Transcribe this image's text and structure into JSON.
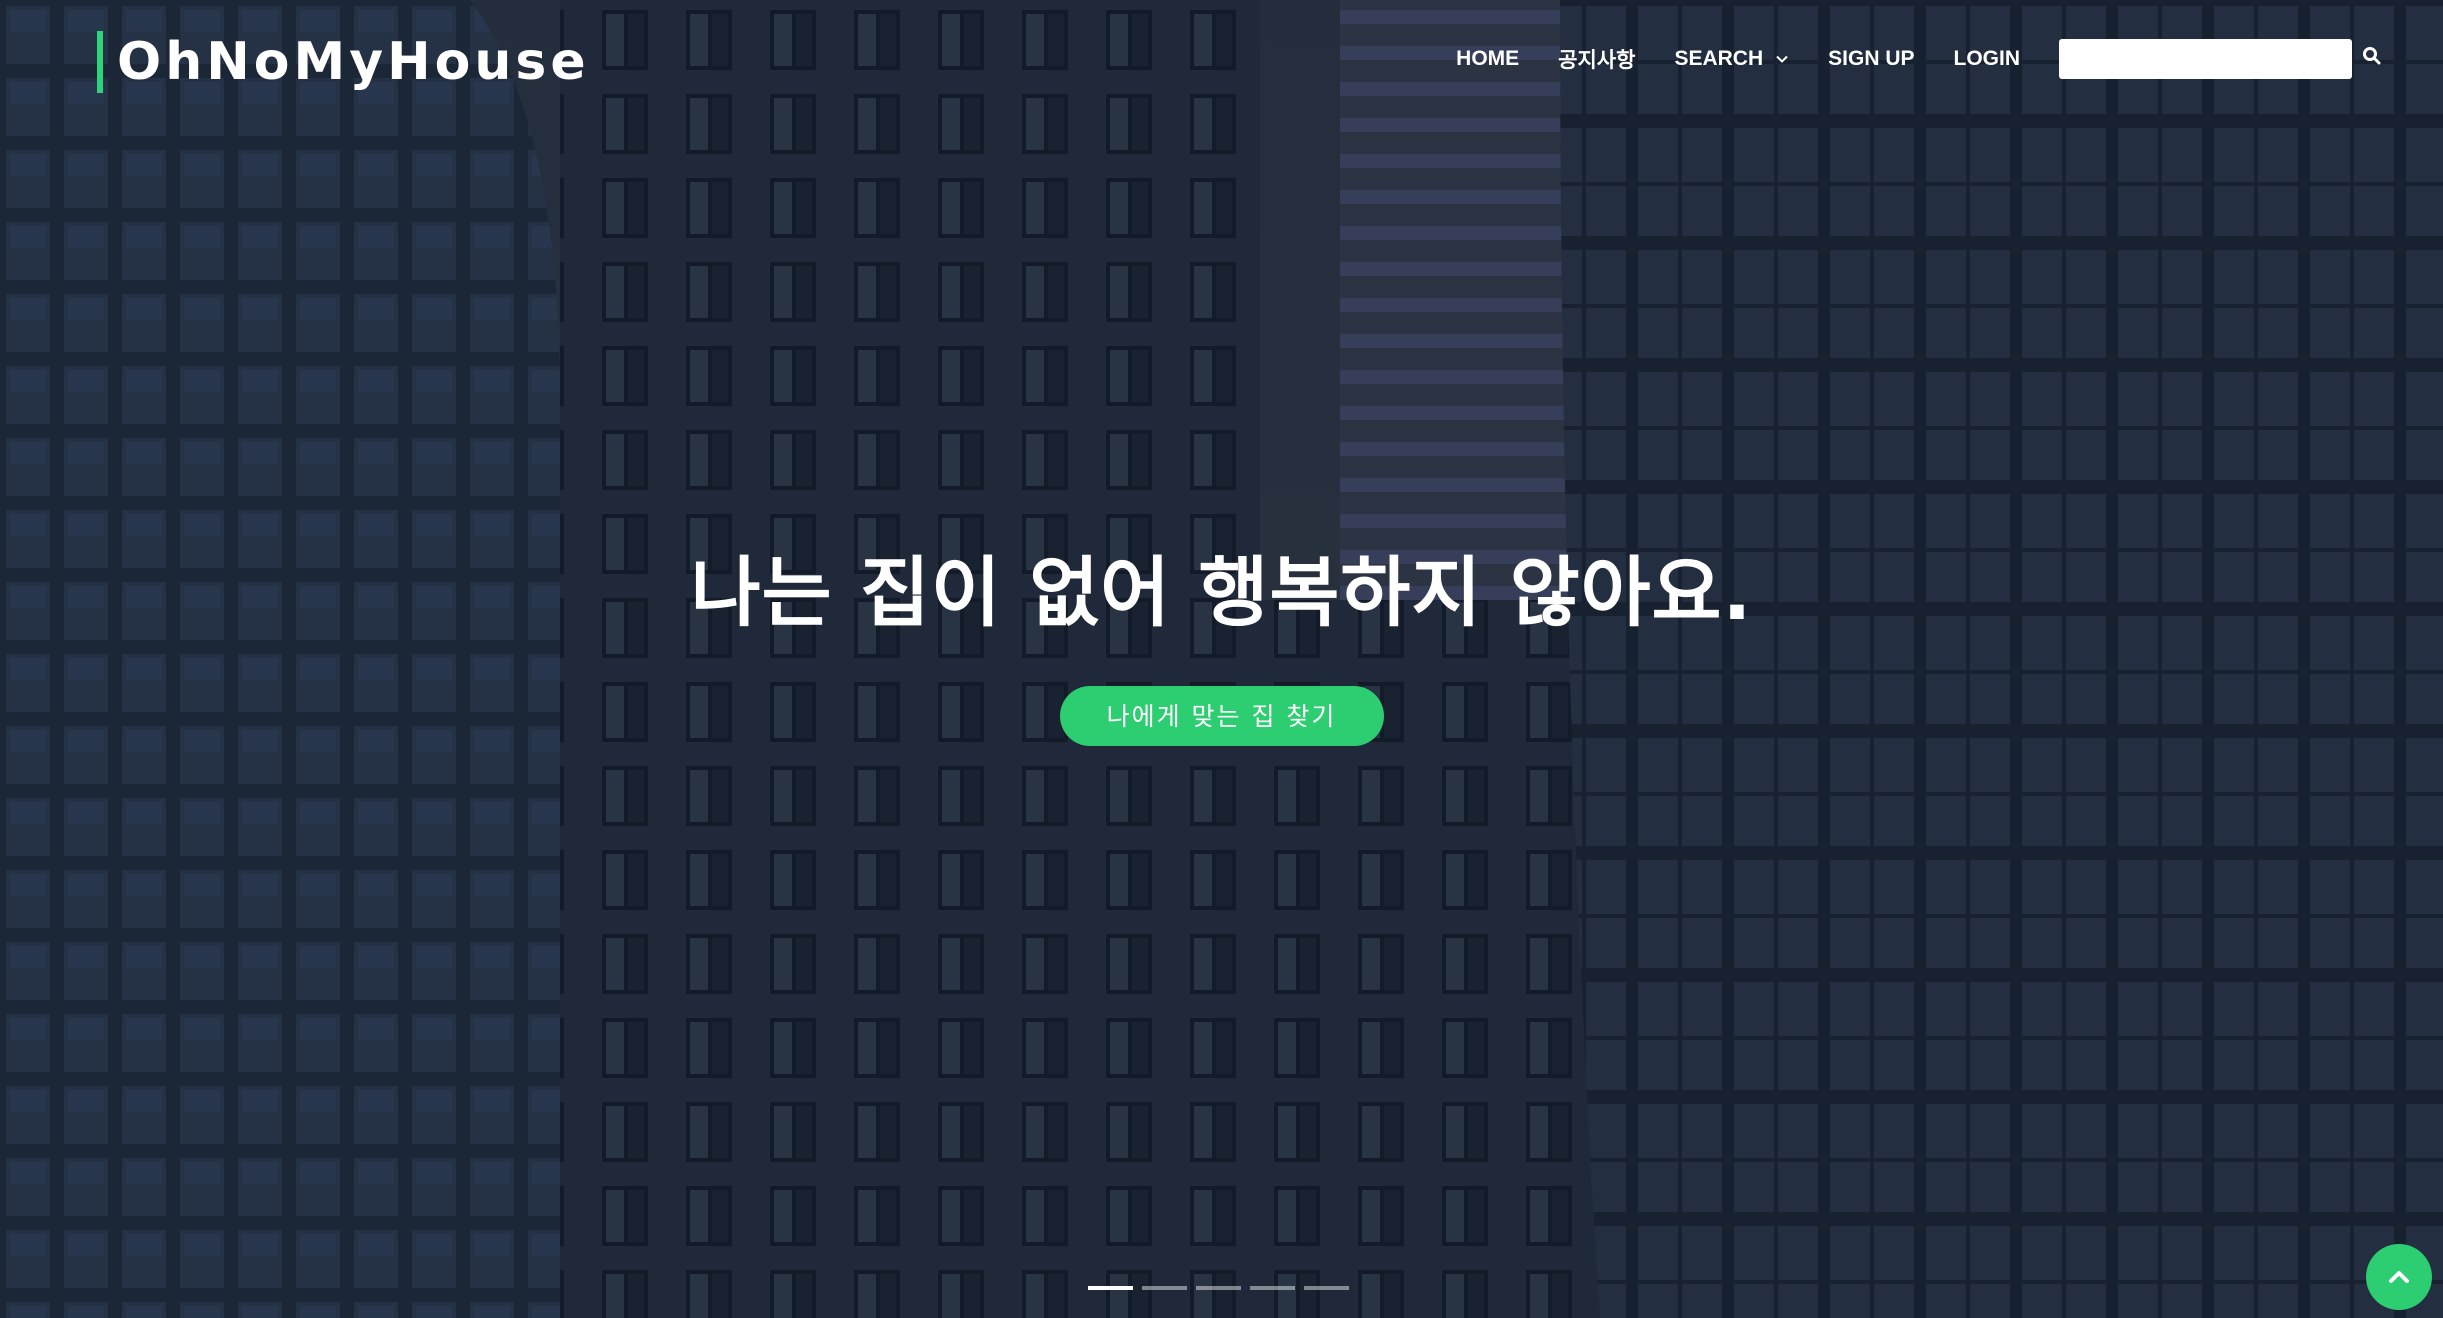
{
  "brand": {
    "name": "OhNoMyHouse",
    "accent_color": "#2ed47a"
  },
  "nav": {
    "items": [
      {
        "label": "HOME"
      },
      {
        "label": "공지사항"
      },
      {
        "label": "SEARCH",
        "icon": "chevron-down-icon"
      },
      {
        "label": "SIGN UP"
      },
      {
        "label": "LOGIN"
      }
    ],
    "search": {
      "value": "",
      "placeholder": "",
      "icon": "search-icon"
    }
  },
  "hero": {
    "title": "나는 집이 없어 행복하지 않아요.",
    "cta_label": "나에게 맞는 집 찾기",
    "cta_color": "#2dce72",
    "background": "city-buildings-photo"
  },
  "carousel": {
    "slide_count": 5,
    "active_index": 0
  },
  "back_to_top": {
    "icon": "chevron-up-icon",
    "color": "#2dce72"
  }
}
